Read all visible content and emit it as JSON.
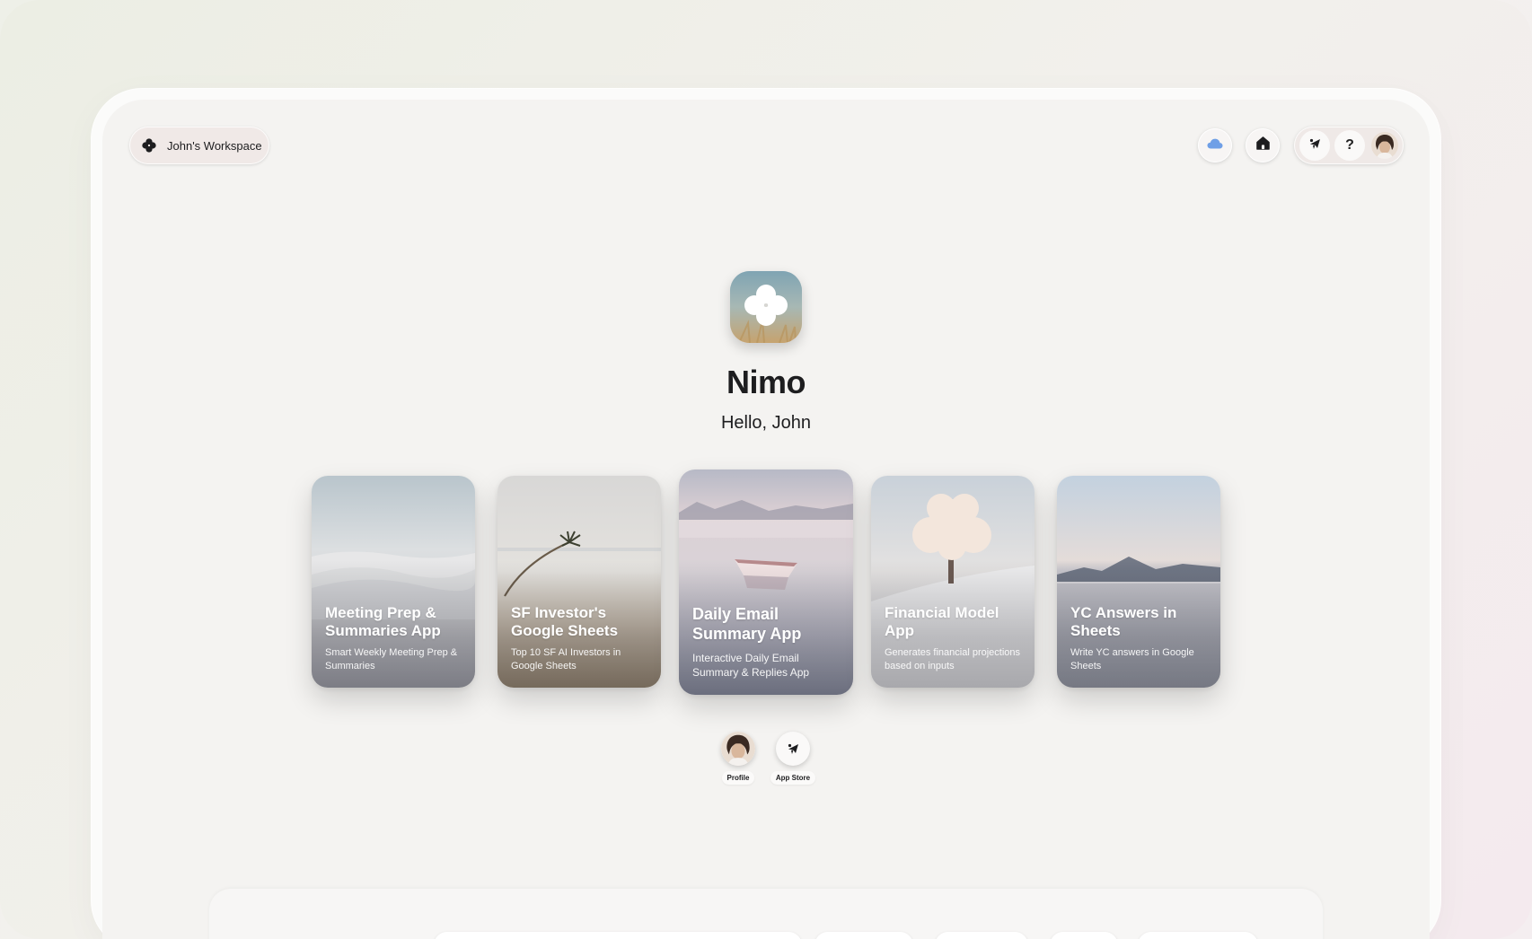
{
  "workspace": {
    "label": "John's Workspace",
    "icon": "clover-icon"
  },
  "topbar": {
    "buttons": [
      {
        "name": "cloud-icon",
        "color": "#6f9fe6"
      },
      {
        "name": "home-icon"
      },
      {
        "name": "app-store-icon"
      },
      {
        "name": "help-icon",
        "glyph": "?"
      },
      {
        "name": "avatar"
      }
    ]
  },
  "hero": {
    "title": "Nimo",
    "greeting": "Hello, John"
  },
  "cards": [
    {
      "title": "Meeting Prep & Summaries App",
      "description": "Smart Weekly Meeting Prep & Summaries",
      "scene": "sand-dunes"
    },
    {
      "title": "SF Investor's Google Sheets",
      "description": "Top 10 SF AI Investors in Google Sheets",
      "scene": "palm-tree"
    },
    {
      "title": "Daily Email Summary App",
      "description": "Interactive Daily Email Summary & Replies App",
      "scene": "boat-lake"
    },
    {
      "title": "Financial Model App",
      "description": "Generates financial projections based on inputs",
      "scene": "snow-tree"
    },
    {
      "title": "YC Answers in Sheets",
      "description": "Write YC answers in Google Sheets",
      "scene": "mountain-lake"
    }
  ],
  "dock": [
    {
      "label": "Profile",
      "icon": "avatar"
    },
    {
      "label": "App Store",
      "icon": "app-store-icon"
    }
  ]
}
